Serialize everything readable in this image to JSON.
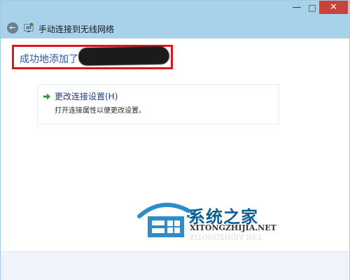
{
  "window": {
    "minimize_glyph": "—",
    "maximize_glyph": "□",
    "close_glyph": "✕"
  },
  "nav": {
    "back_icon": "back-arrow-icon",
    "network_icon": "wireless-network-icon",
    "title": "手动连接到无线网络"
  },
  "main": {
    "success_prefix": "成功地添加了",
    "ssid_redacted": true,
    "highlight_color": "#e3141a"
  },
  "option": {
    "icon": "green-arrow-icon",
    "title": "更改连接设置(H)",
    "description": "打开连接属性以便更改设置。"
  },
  "watermark": {
    "logo": "xitongzhijia-logo",
    "text_cn": "系统之家",
    "text_en": "XITONGZHIJIA.NET",
    "text_en_reflection": "XITONGZHIJIA.NET"
  },
  "colors": {
    "titlebar": "#a7d2ea",
    "link_blue": "#2e56a8",
    "close_red": "#c7433b",
    "watermark_blue": "#0e5f93"
  }
}
